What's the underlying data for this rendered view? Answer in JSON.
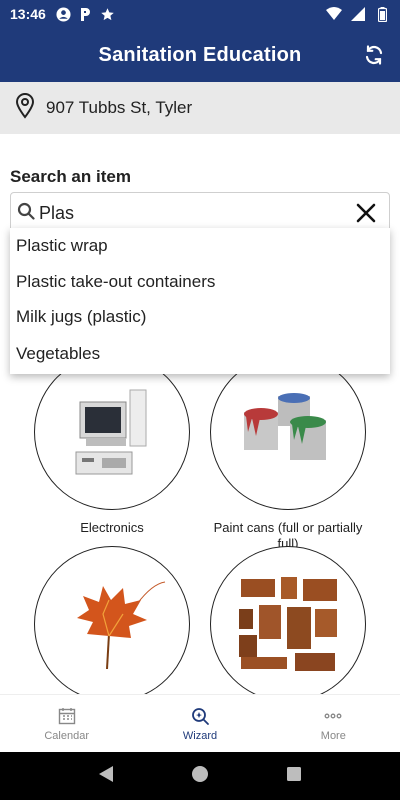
{
  "status_bar": {
    "time": "13:46",
    "left_icons": [
      "account-circle-icon",
      "parking-icon",
      "star-icon"
    ],
    "right_icons": [
      "wifi-icon",
      "signal-icon",
      "battery-icon"
    ]
  },
  "app_bar": {
    "title": "Sanitation Education",
    "refresh_icon": "refresh-icon"
  },
  "address": {
    "text": "907 Tubbs St, Tyler",
    "icon": "location-pin-icon"
  },
  "search": {
    "label": "Search an item",
    "value": "Plas",
    "icon": "search-icon",
    "clear_icon": "close-icon"
  },
  "suggestions": [
    "Plastic wrap",
    "Plastic take-out containers",
    "Milk jugs (plastic)",
    "Vegetables"
  ],
  "categories": [
    {
      "label": "Electronics",
      "image": "computer-image"
    },
    {
      "label": "Paint cans (full or partially full)",
      "image": "paint-cans-image"
    },
    {
      "label": "",
      "image": "autumn-leaf-image"
    },
    {
      "label": "",
      "image": "furniture-image"
    }
  ],
  "bottom_nav": [
    {
      "label": "Calendar",
      "icon": "calendar-icon",
      "active": false
    },
    {
      "label": "Wizard",
      "icon": "wizard-search-icon",
      "active": true
    },
    {
      "label": "More",
      "icon": "more-dots-icon",
      "active": false
    }
  ],
  "colors": {
    "primary": "#1f3a7a",
    "inactive": "#888888"
  }
}
